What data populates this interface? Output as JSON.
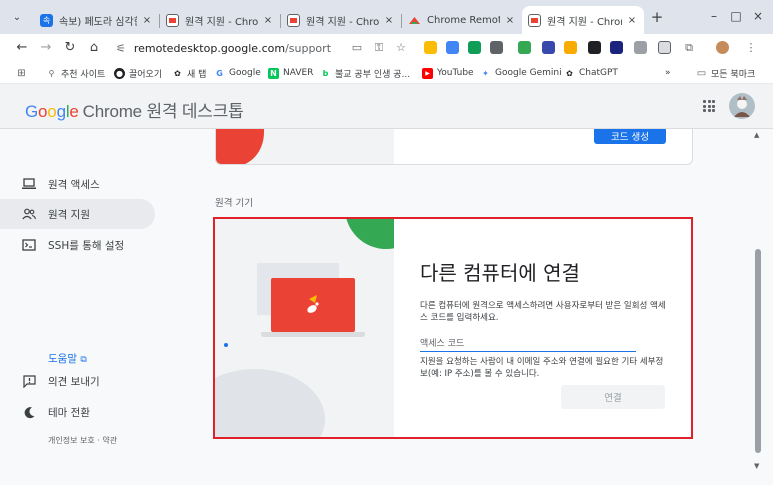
{
  "browser": {
    "tabs": [
      {
        "title": "속보) 페도라 심각한",
        "active": false,
        "favicon_color": "#1a73e8"
      },
      {
        "title": "원격 지원 - Chrome",
        "active": false,
        "favicon_color": "#ea4335"
      },
      {
        "title": "원격 지원 - Chrome",
        "active": false,
        "favicon_color": "#ea4335"
      },
      {
        "title": "Chrome Remote D",
        "active": false,
        "favicon_color": "#ea4335"
      },
      {
        "title": "원격 지원 - Chrome",
        "active": true,
        "favicon_color": "#ea4335"
      }
    ],
    "tab_close_glyph": "×",
    "new_tab_glyph": "+",
    "window_controls": {
      "minimize": "–",
      "maximize": "□",
      "close": "×"
    },
    "url": {
      "host": "remotedesktop.google.com",
      "path": "/support"
    },
    "bookmarks": [
      {
        "label": "추천 사이트",
        "icon": "search-icon"
      },
      {
        "label": "끌어오기",
        "icon": "github-icon"
      },
      {
        "label": "새 탭",
        "icon": "chatgpt-icon"
      },
      {
        "label": "Google",
        "icon": "google-icon"
      },
      {
        "label": "NAVER",
        "icon": "naver-icon"
      },
      {
        "label": "불교 공부 인생 공...",
        "icon": "blog-icon"
      },
      {
        "label": "YouTube",
        "icon": "youtube-icon"
      },
      {
        "label": "Google Gemini",
        "icon": "gemini-icon"
      },
      {
        "label": "ChatGPT",
        "icon": "chatgpt-icon"
      }
    ],
    "bookmarks_overflow": "»",
    "all_bookmarks": "모든 북마크"
  },
  "app": {
    "logo": {
      "g": "G",
      "o1": "o",
      "o2": "o",
      "g2": "g",
      "l": "l",
      "e": "e",
      "product": "Chrome 원격 데스크톱"
    },
    "nav": [
      {
        "label": "원격 액세스",
        "icon": "laptop-icon",
        "active": false
      },
      {
        "label": "원격 지원",
        "icon": "people-icon",
        "active": true
      },
      {
        "label": "SSH를 통해 설정",
        "icon": "terminal-icon",
        "active": false
      }
    ],
    "help": "도움말",
    "feedback": "의견 보내기",
    "theme": "테마 전환",
    "footer": "개인정보 보호 · 약관",
    "generate_code_label": "코드 생성",
    "section_label": "원격 기기",
    "connect": {
      "heading": "다른 컴퓨터에 연결",
      "description": "다른 컴퓨터에 원격으로 액세스하려면 사용자로부터 받은 일회성 액세스 코드를 입력하세요.",
      "input_placeholder": "액세스 코드",
      "input_value": "",
      "helper": "지원을 요청하는 사람이 내 이메일 주소와 연결에 필요한 기타 세부정보(예: IP 주소)를 볼 수 있습니다.",
      "button_label": "연결"
    }
  },
  "colors": {
    "accent": "#1a73e8",
    "red": "#ea4335",
    "green": "#34a853",
    "highlight": "#e2202a"
  }
}
